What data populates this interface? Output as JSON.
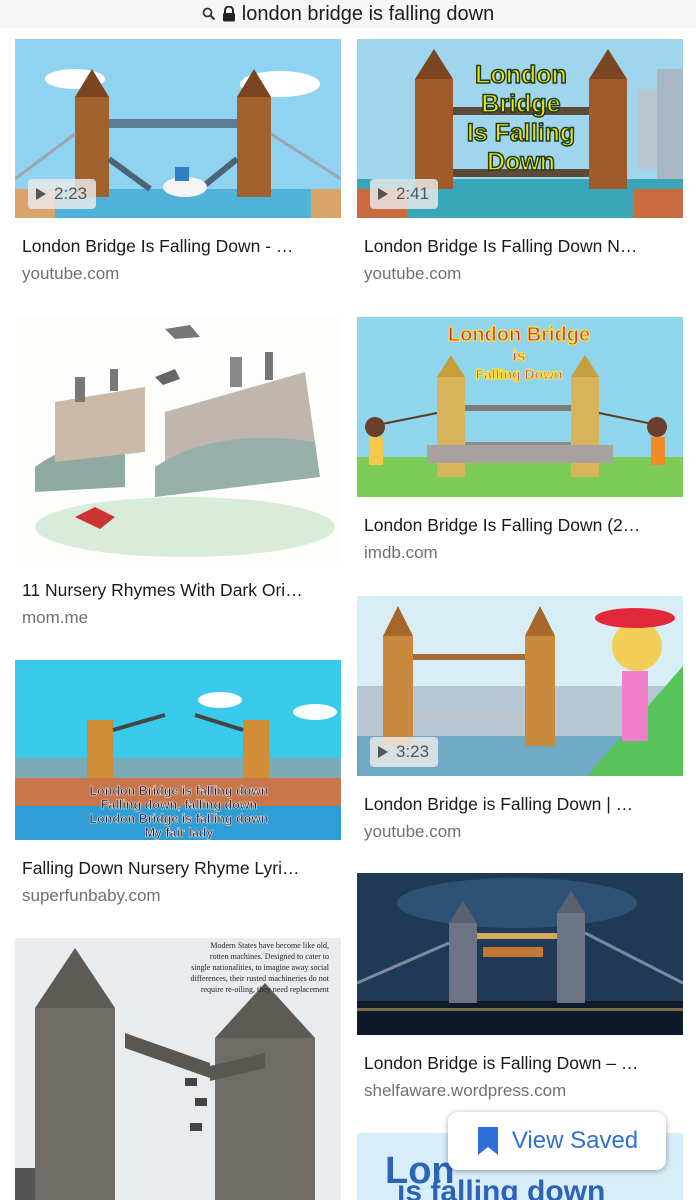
{
  "search": {
    "query": "london bridge is falling down"
  },
  "icons": {
    "search": "search-icon",
    "lock": "lock-icon",
    "play": "play-icon",
    "bookmark": "bookmark-icon"
  },
  "colors": {
    "accent": "#2f6fd8",
    "source": "#707070",
    "title": "#1a1a1a"
  },
  "results": [
    {
      "title": "London Bridge Is Falling Down - …",
      "source": "youtube.com",
      "duration": "2:23"
    },
    {
      "title": "London Bridge Is Falling Down N…",
      "source": "youtube.com",
      "duration": "2:41",
      "overlay": [
        "London",
        "Bridge",
        "Is Falling",
        "Down"
      ]
    },
    {
      "title": "11 Nursery Rhymes With Dark Ori…",
      "source": "mom.me"
    },
    {
      "title": "London Bridge Is Falling Down (2…",
      "source": "imdb.com",
      "overlay": [
        "London Bridge",
        "is",
        "Falling Down"
      ]
    },
    {
      "title": "London Bridge is Falling Down | …",
      "source": "youtube.com",
      "duration": "3:23"
    },
    {
      "title": "Falling Down Nursery Rhyme Lyri…",
      "source": "superfunbaby.com",
      "overlay": [
        "London Bridge is falling down",
        "Falling down, falling down",
        "London Bridge is falling down",
        "My fair lady"
      ]
    },
    {
      "title": "London Bridge is Falling Down – …",
      "source": "shelfaware.wordpress.com"
    },
    {
      "overlay": [
        "Modern States have become like old,",
        "rotten machines. Designed to cater to",
        "single nationalities, to imagine away social",
        "differences, their rusted machineries do not",
        "require re-oiling, they need replacement"
      ]
    },
    {
      "overlay": [
        "Lon",
        "is falling down"
      ]
    }
  ],
  "view_saved": {
    "label": "View Saved"
  }
}
